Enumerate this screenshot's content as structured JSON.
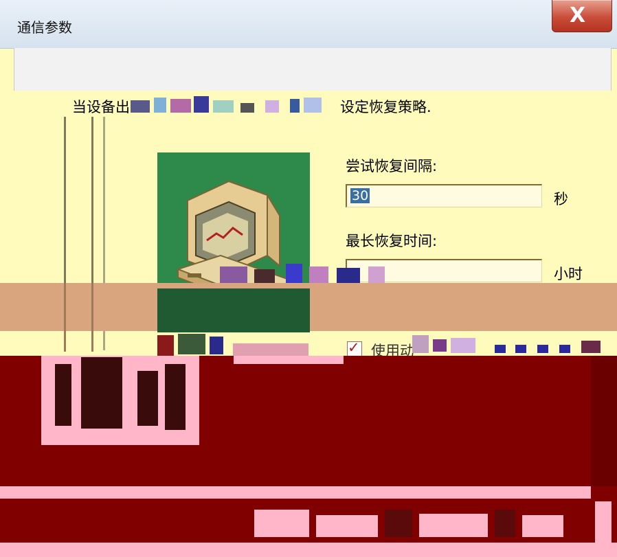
{
  "window": {
    "title": "通信参数",
    "close_glyph": "X"
  },
  "description": {
    "text_start": "当设备出",
    "text_end": "设定恢复策略."
  },
  "retry_interval": {
    "label": "尝试恢复间隔:",
    "value": "30",
    "unit": "秒"
  },
  "max_recovery_time": {
    "label": "最长恢复时间:",
    "value": "",
    "unit": "小时"
  },
  "auto_option": {
    "checked": true,
    "check_glyph": "✓",
    "label": "使用动"
  },
  "illustration": {
    "icon": "computer-icon"
  }
}
